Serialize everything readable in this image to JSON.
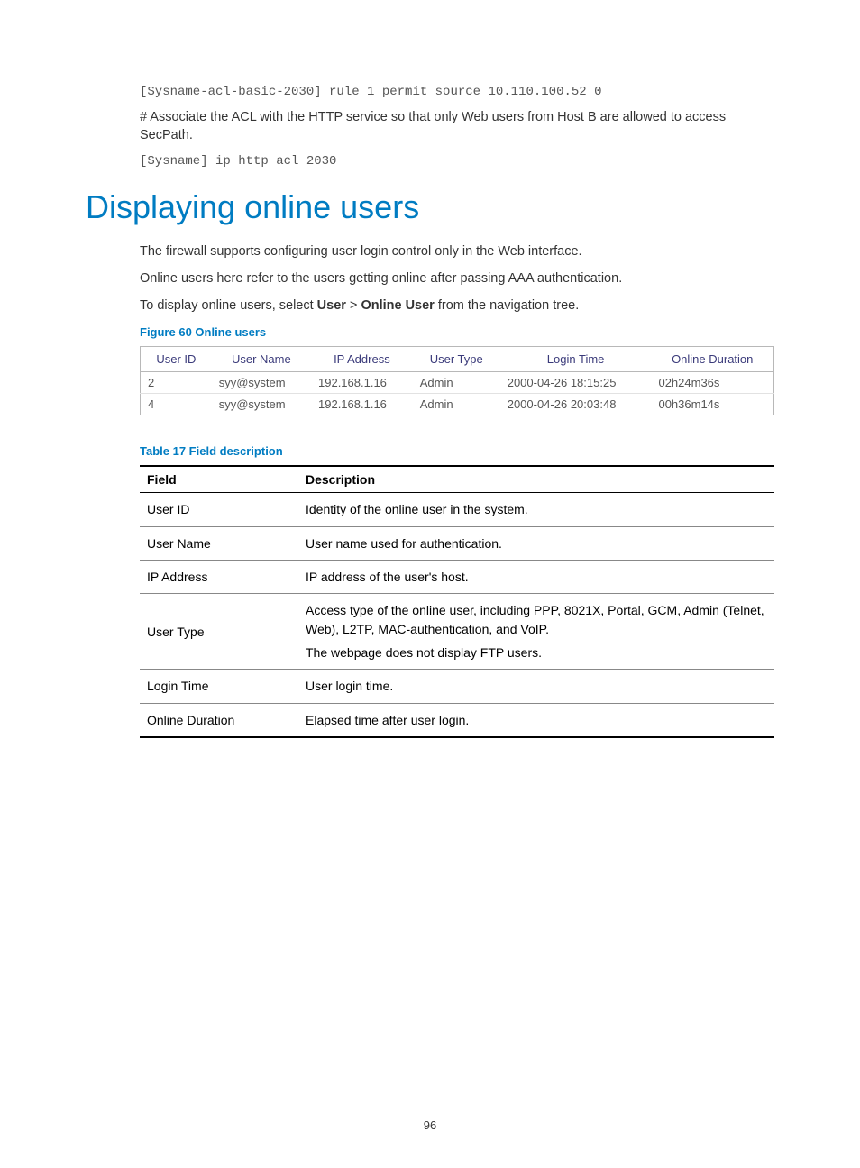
{
  "code_lines": {
    "rule": "[Sysname-acl-basic-2030] rule 1 permit source 10.110.100.52 0",
    "assoc_text": "# Associate the ACL with the HTTP service so that only Web users from Host B are allowed to access SecPath.",
    "http_acl": "[Sysname] ip http acl 2030"
  },
  "heading": "Displaying online users",
  "paragraphs": {
    "p1": "The firewall supports configuring user login control only in the Web interface.",
    "p2": "Online users here refer to the users getting online after passing AAA authentication.",
    "p3_pre": "To display online users, select ",
    "p3_b1": "User",
    "p3_gt": " > ",
    "p3_b2": "Online User",
    "p3_post": " from the navigation tree."
  },
  "figure_caption": "Figure 60 Online users",
  "online_table": {
    "headers": {
      "user_id": "User ID",
      "user_name": "User Name",
      "ip_address": "IP Address",
      "user_type": "User Type",
      "login_time": "Login Time",
      "online_duration": "Online Duration"
    },
    "rows": [
      {
        "user_id": "2",
        "user_name": "syy@system",
        "ip_address": "192.168.1.16",
        "user_type": "Admin",
        "login_time": "2000-04-26 18:15:25",
        "online_duration": "02h24m36s"
      },
      {
        "user_id": "4",
        "user_name": "syy@system",
        "ip_address": "192.168.1.16",
        "user_type": "Admin",
        "login_time": "2000-04-26 20:03:48",
        "online_duration": "00h36m14s"
      }
    ]
  },
  "table_caption": "Table 17 Field description",
  "field_table": {
    "headers": {
      "field": "Field",
      "description": "Description"
    },
    "rows": [
      {
        "field": "User ID",
        "description": "Identity of the online user in the system."
      },
      {
        "field": "User Name",
        "description": "User name used for authentication."
      },
      {
        "field": "IP Address",
        "description": "IP address of the user's host."
      },
      {
        "field": "User Type",
        "description": "Access type of the online user, including PPP, 8021X, Portal, GCM, Admin (Telnet, Web), L2TP, MAC-authentication, and VoIP.",
        "note": "The webpage does not display FTP users."
      },
      {
        "field": "Login Time",
        "description": "User login time."
      },
      {
        "field": "Online Duration",
        "description": "Elapsed time after user login."
      }
    ]
  },
  "page_number": "96"
}
